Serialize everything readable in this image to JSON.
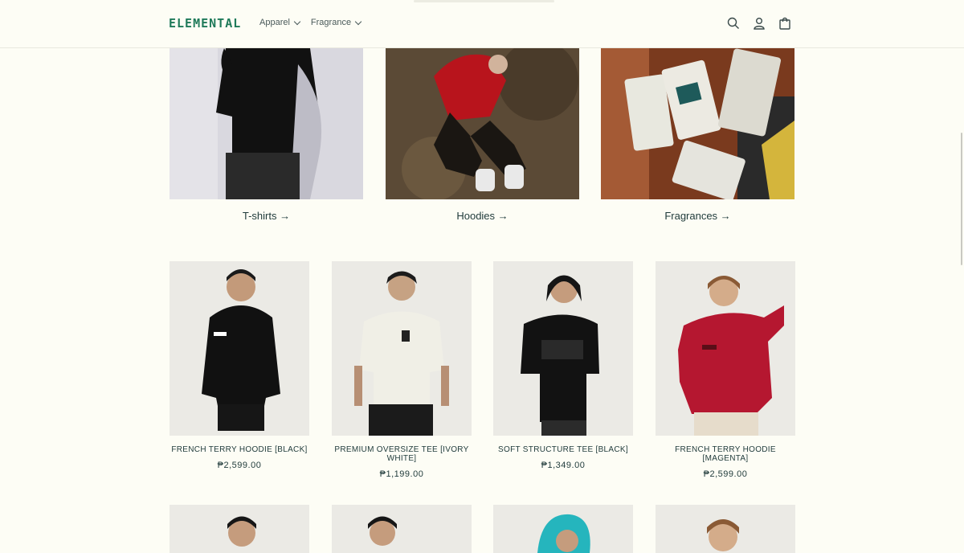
{
  "header": {
    "logo": "ELEMENTAL",
    "nav": [
      {
        "label": "Apparel"
      },
      {
        "label": "Fragrance"
      }
    ],
    "icons": [
      "search-icon",
      "account-icon",
      "cart-icon"
    ]
  },
  "categories": [
    {
      "label": "T-shirts →"
    },
    {
      "label": "Hoodies →"
    },
    {
      "label": "Fragrances →"
    }
  ],
  "products": [
    {
      "name": "FRENCH TERRY HOODIE [BLACK]",
      "price": "₱2,599.00"
    },
    {
      "name": "PREMIUM OVERSIZE TEE [IVORY WHITE]",
      "price": "₱1,199.00"
    },
    {
      "name": "SOFT STRUCTURE TEE [BLACK]",
      "price": "₱1,349.00"
    },
    {
      "name": "FRENCH TERRY HOODIE [MAGENTA]",
      "price": "₱2,599.00"
    }
  ],
  "colors": {
    "background": "#fdfdf5",
    "brand": "#1f7a5a",
    "text": "#1f3a3a"
  }
}
